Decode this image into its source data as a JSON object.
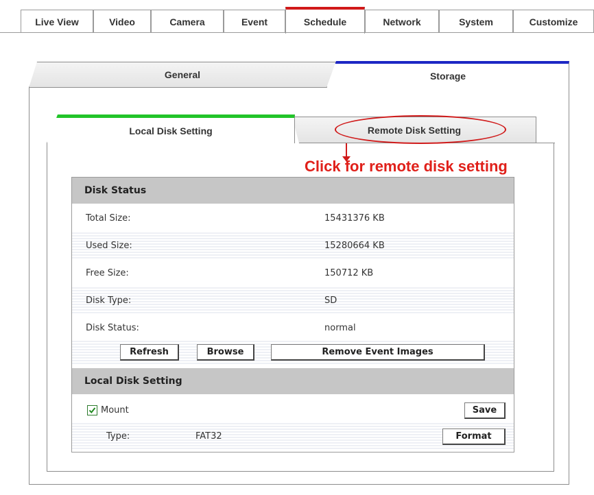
{
  "nav": {
    "tabs": [
      "Live View",
      "Video",
      "Camera",
      "Event",
      "Schedule",
      "Network",
      "System",
      "Customize"
    ],
    "active": "Schedule"
  },
  "subtabs": {
    "general": "General",
    "storage": "Storage"
  },
  "storage_tabs": {
    "local": "Local Disk Setting",
    "remote": "Remote Disk Setting"
  },
  "annotation": {
    "text": "Click for remote disk setting",
    "color": "#e0201a"
  },
  "disk_status": {
    "heading": "Disk Status",
    "rows": [
      {
        "label": "Total Size:",
        "value": "15431376 KB"
      },
      {
        "label": "Used Size:",
        "value": "15280664 KB"
      },
      {
        "label": "Free Size:",
        "value": "150712 KB"
      },
      {
        "label": "Disk Type:",
        "value": "SD"
      },
      {
        "label": "Disk Status:",
        "value": "normal"
      }
    ],
    "buttons": {
      "refresh": "Refresh",
      "browse": "Browse",
      "remove": "Remove Event Images"
    }
  },
  "local_disk": {
    "heading": "Local Disk Setting",
    "mount_label": "Mount",
    "mount_checked": true,
    "save_label": "Save",
    "type_label": "Type:",
    "type_value": "FAT32",
    "format_label": "Format"
  },
  "colors": {
    "active_nav_accent": "#d11a1a",
    "storage_accent": "#1d27c4",
    "local_accent": "#22c42a",
    "annotation": "#d01a1a"
  }
}
